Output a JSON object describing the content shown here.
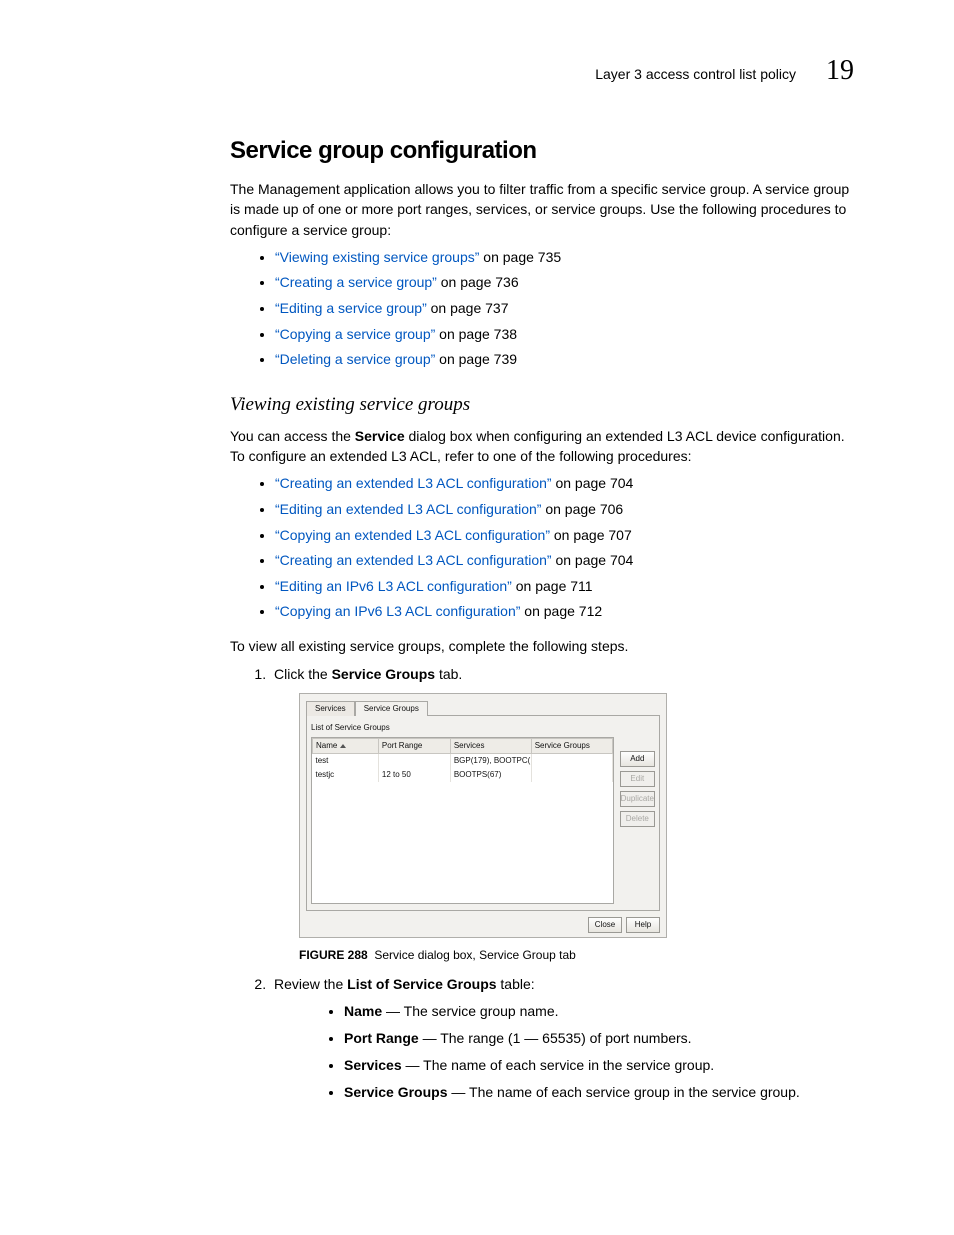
{
  "header": {
    "section": "Layer 3 access control list policy",
    "chapter_number": "19"
  },
  "h2": "Service group configuration",
  "intro": "The Management application allows you to filter traffic from a specific service group. A service group is made up of one or more port ranges, services, or service groups. Use the following procedures to configure a service group:",
  "procedures": [
    {
      "link": "“Viewing existing service groups”",
      "rest": " on page 735"
    },
    {
      "link": "“Creating a service group”",
      "rest": " on page 736"
    },
    {
      "link": "“Editing a service group”",
      "rest": " on page 737"
    },
    {
      "link": "“Copying a service group”",
      "rest": " on page 738"
    },
    {
      "link": "“Deleting a service group”",
      "rest": " on page 739"
    }
  ],
  "h3": "Viewing existing service groups",
  "para2a": "You can access the ",
  "para2b_bold": "Service",
  "para2c": " dialog box when configuring an extended L3 ACL device configuration. To configure an extended L3 ACL, refer to one of the following procedures:",
  "acl_links": [
    {
      "link": "“Creating an extended L3 ACL configuration”",
      "rest": " on page 704"
    },
    {
      "link": "“Editing an extended L3 ACL configuration”",
      "rest": " on page 706"
    },
    {
      "link": "“Copying an extended L3 ACL configuration”",
      "rest": " on page 707"
    },
    {
      "link": "“Creating an extended L3 ACL configuration”",
      "rest": " on page 704"
    },
    {
      "link": "“Editing an IPv6 L3 ACL configuration”",
      "rest": " on page 711"
    },
    {
      "link": "“Copying an IPv6 L3 ACL configuration”",
      "rest": " on page 712"
    }
  ],
  "para3": "To view all existing service groups, complete the following steps.",
  "step1_a": "Click the ",
  "step1_b_bold": "Service Groups",
  "step1_c": " tab.",
  "dialog": {
    "tabs": {
      "0": "Services",
      "1": "Service Groups"
    },
    "list_label": "List of Service Groups",
    "columns": {
      "0": "Name",
      "1": "Port Range",
      "2": "Services",
      "3": "Service Groups"
    },
    "rows": [
      {
        "name": "test",
        "port_range": "",
        "services": "BGP(179), BOOTPC(...",
        "groups": ""
      },
      {
        "name": "testjc",
        "port_range": "12 to 50",
        "services": "BOOTPS(67)",
        "groups": ""
      }
    ],
    "side_buttons": {
      "add": "Add",
      "edit": "Edit",
      "duplicate": "Duplicate",
      "delete": "Delete"
    },
    "bottom_buttons": {
      "close": "Close",
      "help": "Help"
    }
  },
  "figure": {
    "num": "FIGURE 288",
    "caption": "Service dialog box, Service Group tab"
  },
  "step2_a": "Review the ",
  "step2_b_bold": "List of Service Groups",
  "step2_c": " table:",
  "step2_items": [
    {
      "bold": "Name",
      "rest": " — The service group name."
    },
    {
      "bold": "Port Range",
      "rest": " — The range (1 — 65535) of port numbers."
    },
    {
      "bold": "Services",
      "rest": " — The name of each service in the service group."
    },
    {
      "bold": "Service Groups",
      "rest": " — The name of each service group in the service group."
    }
  ]
}
